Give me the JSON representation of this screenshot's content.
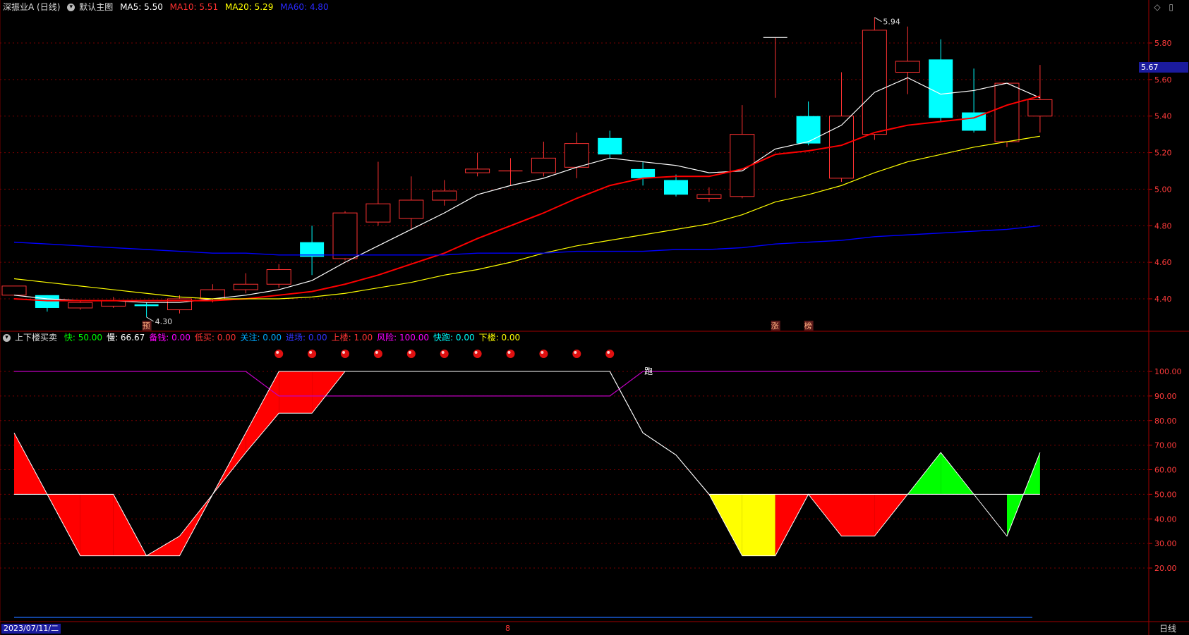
{
  "header": {
    "stock_name": "深振业A (日线)",
    "main_chart_label": "默认主图",
    "ma5_label": "MA5: 5.50",
    "ma10_label": "MA10: 5.51",
    "ma20_label": "MA20: 5.29",
    "ma60_label": "MA60: 4.80",
    "icon_names": [
      "diamond-icon",
      "restore-icon"
    ]
  },
  "indicator_header": {
    "name": "上下楼买卖",
    "items": [
      {
        "label": "快: 50.00",
        "color": "#00ff00"
      },
      {
        "label": "慢: 66.67",
        "color": "#ffffff"
      },
      {
        "label": "备钱: 0.00",
        "color": "#ff00ff"
      },
      {
        "label": "低买: 0.00",
        "color": "#ff3333"
      },
      {
        "label": "关注: 0.00",
        "color": "#00aaff"
      },
      {
        "label": "进场: 0.00",
        "color": "#3333ff"
      },
      {
        "label": "上楼: 1.00",
        "color": "#ff3333"
      },
      {
        "label": "风险: 100.00",
        "color": "#ff00ff"
      },
      {
        "label": "快跑: 0.00",
        "color": "#00ffff"
      },
      {
        "label": "下楼: 0.00",
        "color": "#ffff00"
      }
    ]
  },
  "price_axis": {
    "ticks": [
      "5.80",
      "5.60",
      "5.40",
      "5.20",
      "5.00",
      "4.80",
      "4.60",
      "4.40"
    ],
    "current_price": "5.67"
  },
  "indicator_axis": {
    "ticks": [
      "100.00",
      "90.00",
      "80.00",
      "70.00",
      "60.00",
      "50.00",
      "40.00",
      "30.00",
      "20.00"
    ]
  },
  "footer": {
    "date": "2023/07/11/二",
    "month_marker": "8",
    "period": "日线"
  },
  "colors": {
    "up": "#ff3232",
    "down": "#00ffff",
    "ma5": "#ffffff",
    "ma10": "#ff0000",
    "ma20": "#ffff00",
    "ma60": "#0000ff",
    "grid": "#7a0000"
  },
  "chart_data": [
    {
      "type": "candlestick",
      "title": "深振业A (日线)",
      "ylim": [
        4.2,
        5.98
      ],
      "annotations": [
        {
          "text": "5.94",
          "x": 26,
          "y": 5.94
        },
        {
          "text": "4.30",
          "x": 4,
          "y": 4.3
        },
        {
          "text": "预",
          "x": 4
        },
        {
          "text": "涨",
          "x": 23
        },
        {
          "text": "榜",
          "x": 24
        }
      ],
      "candles": [
        {
          "o": 4.42,
          "c": 4.47,
          "h": 4.47,
          "l": 4.42
        },
        {
          "o": 4.42,
          "c": 4.35,
          "h": 4.42,
          "l": 4.33
        },
        {
          "o": 4.35,
          "c": 4.38,
          "h": 4.39,
          "l": 4.34
        },
        {
          "o": 4.36,
          "c": 4.39,
          "h": 4.41,
          "l": 4.35
        },
        {
          "o": 4.37,
          "c": 4.36,
          "h": 4.38,
          "l": 4.3
        },
        {
          "o": 4.34,
          "c": 4.4,
          "h": 4.42,
          "l": 4.32
        },
        {
          "o": 4.4,
          "c": 4.45,
          "h": 4.48,
          "l": 4.38
        },
        {
          "o": 4.45,
          "c": 4.48,
          "h": 4.54,
          "l": 4.43
        },
        {
          "o": 4.48,
          "c": 4.56,
          "h": 4.59,
          "l": 4.46
        },
        {
          "o": 4.71,
          "c": 4.63,
          "h": 4.8,
          "l": 4.53
        },
        {
          "o": 4.62,
          "c": 4.87,
          "h": 4.88,
          "l": 4.61
        },
        {
          "o": 4.82,
          "c": 4.92,
          "h": 5.15,
          "l": 4.8
        },
        {
          "o": 4.84,
          "c": 4.94,
          "h": 5.07,
          "l": 4.78
        },
        {
          "o": 4.94,
          "c": 4.99,
          "h": 5.05,
          "l": 4.91
        },
        {
          "o": 5.09,
          "c": 5.11,
          "h": 5.2,
          "l": 5.07
        },
        {
          "o": 5.1,
          "c": 5.1,
          "h": 5.17,
          "l": 5.02
        },
        {
          "o": 5.09,
          "c": 5.17,
          "h": 5.26,
          "l": 5.07
        },
        {
          "o": 5.12,
          "c": 5.25,
          "h": 5.31,
          "l": 5.06
        },
        {
          "o": 5.28,
          "c": 5.19,
          "h": 5.32,
          "l": 5.17
        },
        {
          "o": 5.11,
          "c": 5.06,
          "h": 5.15,
          "l": 5.02
        },
        {
          "o": 5.05,
          "c": 4.97,
          "h": 5.08,
          "l": 4.96
        },
        {
          "o": 4.95,
          "c": 4.97,
          "h": 5.01,
          "l": 4.93
        },
        {
          "o": 4.96,
          "c": 5.3,
          "h": 5.46,
          "l": 4.95
        },
        {
          "o": 5.83,
          "c": 5.83,
          "h": 5.83,
          "l": 5.5
        },
        {
          "o": 5.4,
          "c": 5.25,
          "h": 5.48,
          "l": 5.24
        },
        {
          "o": 5.06,
          "c": 5.4,
          "h": 5.64,
          "l": 5.04
        },
        {
          "o": 5.3,
          "c": 5.87,
          "h": 5.94,
          "l": 5.27
        },
        {
          "o": 5.64,
          "c": 5.7,
          "h": 5.89,
          "l": 5.52
        },
        {
          "o": 5.71,
          "c": 5.39,
          "h": 5.82,
          "l": 5.37
        },
        {
          "o": 5.42,
          "c": 5.32,
          "h": 5.66,
          "l": 5.31
        },
        {
          "o": 5.26,
          "c": 5.58,
          "h": 5.58,
          "l": 5.23
        },
        {
          "o": 5.4,
          "c": 5.49,
          "h": 5.68,
          "l": 5.31
        }
      ],
      "series": [
        {
          "name": "MA5",
          "values": [
            4.42,
            4.4,
            4.39,
            4.39,
            4.38,
            4.38,
            4.4,
            4.42,
            4.45,
            4.5,
            4.6,
            4.69,
            4.78,
            4.87,
            4.97,
            5.02,
            5.06,
            5.12,
            5.17,
            5.15,
            5.13,
            5.09,
            5.1,
            5.22,
            5.26,
            5.35,
            5.53,
            5.61,
            5.52,
            5.54,
            5.58,
            5.5
          ]
        },
        {
          "name": "MA10",
          "values": [
            4.4,
            4.39,
            4.39,
            4.39,
            4.39,
            4.39,
            4.39,
            4.4,
            4.42,
            4.44,
            4.48,
            4.53,
            4.59,
            4.65,
            4.73,
            4.8,
            4.87,
            4.95,
            5.02,
            5.06,
            5.07,
            5.07,
            5.11,
            5.19,
            5.21,
            5.24,
            5.31,
            5.35,
            5.37,
            5.39,
            5.46,
            5.51
          ]
        },
        {
          "name": "MA20",
          "values": [
            4.51,
            4.49,
            4.47,
            4.45,
            4.43,
            4.41,
            4.4,
            4.4,
            4.4,
            4.41,
            4.43,
            4.46,
            4.49,
            4.53,
            4.56,
            4.6,
            4.65,
            4.69,
            4.72,
            4.75,
            4.78,
            4.81,
            4.86,
            4.93,
            4.97,
            5.02,
            5.09,
            5.15,
            5.19,
            5.23,
            5.26,
            5.29
          ]
        },
        {
          "name": "MA60",
          "values": [
            4.71,
            4.7,
            4.69,
            4.68,
            4.67,
            4.66,
            4.65,
            4.65,
            4.64,
            4.64,
            4.64,
            4.64,
            4.64,
            4.64,
            4.65,
            4.65,
            4.65,
            4.66,
            4.66,
            4.66,
            4.67,
            4.67,
            4.68,
            4.7,
            4.71,
            4.72,
            4.74,
            4.75,
            4.76,
            4.77,
            4.78,
            4.8
          ]
        }
      ]
    },
    {
      "type": "line",
      "title": "上下楼买卖",
      "ylim": [
        0,
        115
      ],
      "series": [
        {
          "name": "快",
          "values": [
            50,
            50,
            50,
            50,
            25,
            33,
            50,
            67,
            83,
            83,
            100,
            100,
            100,
            100,
            100,
            100,
            100,
            100,
            100,
            75,
            66,
            50,
            50,
            50,
            50,
            50,
            50,
            50,
            50,
            50,
            50,
            50
          ]
        },
        {
          "name": "慢",
          "values": [
            75,
            50,
            25,
            25,
            25,
            25,
            50,
            75,
            100,
            100,
            100,
            100,
            100,
            100,
            100,
            100,
            100,
            100,
            100,
            75,
            66,
            50,
            25,
            25,
            50,
            33,
            33,
            50,
            67,
            50,
            33,
            67
          ]
        },
        {
          "name": "风险",
          "values": [
            100,
            100,
            100,
            100,
            100,
            100,
            100,
            100,
            90,
            90,
            90,
            90,
            90,
            90,
            90,
            90,
            90,
            90,
            90,
            100,
            100,
            100,
            100,
            100,
            100,
            100,
            100,
            100,
            100,
            100,
            100,
            100
          ]
        }
      ],
      "markers": {
        "ball_indices": [
          8,
          9,
          10,
          11,
          12,
          13,
          14,
          15,
          16,
          17,
          18
        ],
        "run_label": "跑",
        "run_index": 19
      }
    }
  ]
}
